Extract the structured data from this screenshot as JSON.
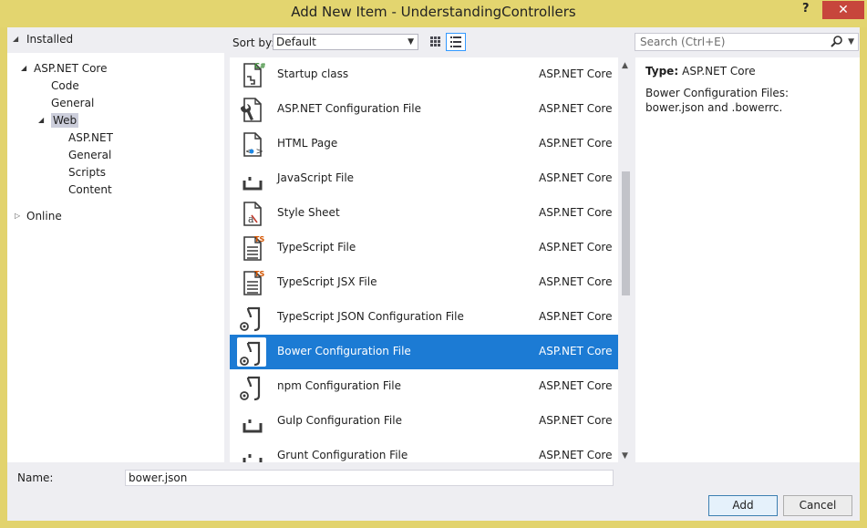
{
  "window": {
    "title": "Add New Item - UnderstandingControllers",
    "help": "?",
    "close": "✕"
  },
  "tree": {
    "installed": "Installed",
    "items": [
      {
        "label": "ASP.NET Core",
        "twisty": "◢"
      },
      {
        "label": "Code",
        "twisty": ""
      },
      {
        "label": "General",
        "twisty": ""
      },
      {
        "label": "Web",
        "twisty": "◢"
      },
      {
        "label": "ASP.NET",
        "twisty": ""
      },
      {
        "label": "General",
        "twisty": ""
      },
      {
        "label": "Scripts",
        "twisty": ""
      },
      {
        "label": "Content",
        "twisty": ""
      }
    ],
    "online": "Online"
  },
  "toolbar": {
    "sort_label": "Sort by:",
    "sort_value": "Default",
    "search_placeholder": "Search (Ctrl+E)"
  },
  "templates": [
    {
      "name": "Startup class",
      "category": "ASP.NET Core",
      "icon": "csharp-class-icon"
    },
    {
      "name": "ASP.NET Configuration File",
      "category": "ASP.NET Core",
      "icon": "config-file-icon"
    },
    {
      "name": "HTML Page",
      "category": "ASP.NET Core",
      "icon": "html-page-icon"
    },
    {
      "name": "JavaScript File",
      "category": "ASP.NET Core",
      "icon": "javascript-file-icon"
    },
    {
      "name": "Style Sheet",
      "category": "ASP.NET Core",
      "icon": "stylesheet-icon"
    },
    {
      "name": "TypeScript File",
      "category": "ASP.NET Core",
      "icon": "typescript-file-icon"
    },
    {
      "name": "TypeScript JSX File",
      "category": "ASP.NET Core",
      "icon": "typescript-jsx-file-icon"
    },
    {
      "name": "TypeScript JSON Configuration File",
      "category": "ASP.NET Core",
      "icon": "json-config-icon"
    },
    {
      "name": "Bower Configuration File",
      "category": "ASP.NET Core",
      "icon": "json-config-icon"
    },
    {
      "name": "npm Configuration File",
      "category": "ASP.NET Core",
      "icon": "json-config-icon"
    },
    {
      "name": "Gulp Configuration File",
      "category": "ASP.NET Core",
      "icon": "javascript-file-icon"
    },
    {
      "name": "Grunt Configuration File",
      "category": "ASP.NET Core",
      "icon": "javascript-file-icon"
    }
  ],
  "selected_index": 8,
  "details": {
    "type_label": "Type:",
    "type_value": "ASP.NET Core",
    "description": "Bower Configuration Files: bower.json and .bowerrc."
  },
  "footer": {
    "name_label": "Name:",
    "name_value": "bower.json",
    "add_label": "Add",
    "cancel_label": "Cancel"
  },
  "colors": {
    "title_bar": "#e3d56f",
    "selection": "#1c7bd4",
    "close_button": "#c7463c"
  }
}
